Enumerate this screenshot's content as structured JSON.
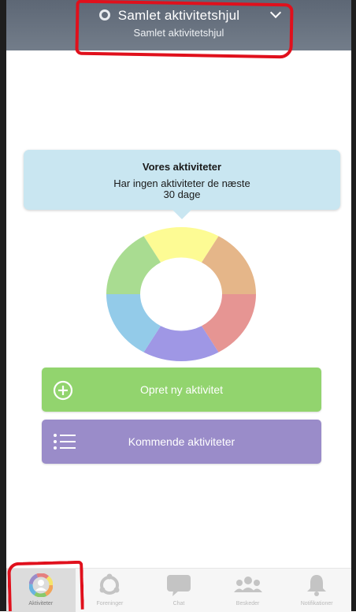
{
  "header": {
    "title": "Samlet aktivitetshjul",
    "subtitle": "Samlet aktivitetshjul",
    "dropdown_icon": "chevron-down-icon",
    "status_icon": "ring-icon"
  },
  "tooltip": {
    "title": "Vores aktiviteter",
    "body": "Har ingen aktiviteter de næste 30 dage"
  },
  "wheel": {
    "segment_colors": [
      "#fdfb94",
      "#e5b689",
      "#e69593",
      "#9f97e5",
      "#93cbe9",
      "#a9dc91"
    ]
  },
  "actions": {
    "create_label": "Opret ny aktivitet",
    "create_icon": "plus-circle-icon",
    "create_color": "#92d46e",
    "upcoming_label": "Kommende aktiviteter",
    "upcoming_icon": "list-icon",
    "upcoming_color": "#9a8cc9"
  },
  "bottom_nav": [
    {
      "label": "Aktiviteter",
      "icon": "activity-wheel-icon",
      "active": true
    },
    {
      "label": "Foreninger",
      "icon": "ring-icon",
      "active": false
    },
    {
      "label": "Chat",
      "icon": "chat-bubble-icon",
      "active": false
    },
    {
      "label": "Beskeder",
      "icon": "group-icon",
      "active": false
    },
    {
      "label": "Notifikationer",
      "icon": "bell-icon",
      "active": false
    }
  ]
}
